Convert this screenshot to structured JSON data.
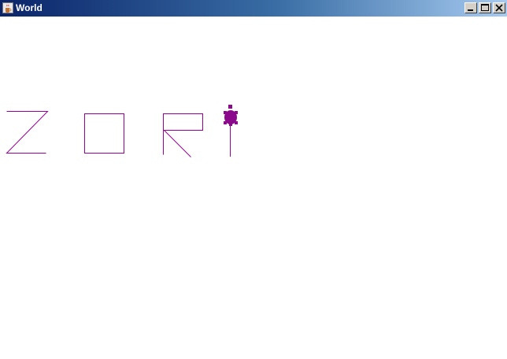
{
  "window": {
    "title": "World",
    "icon": "java-cup-icon",
    "controls": [
      "minimize-icon",
      "maximize-icon",
      "close-icon"
    ]
  },
  "canvas": {
    "background": "#ffffff",
    "pen_color": "#990099",
    "turtle": {
      "color": "#8b0a8b",
      "icon": "turtle-icon"
    }
  }
}
